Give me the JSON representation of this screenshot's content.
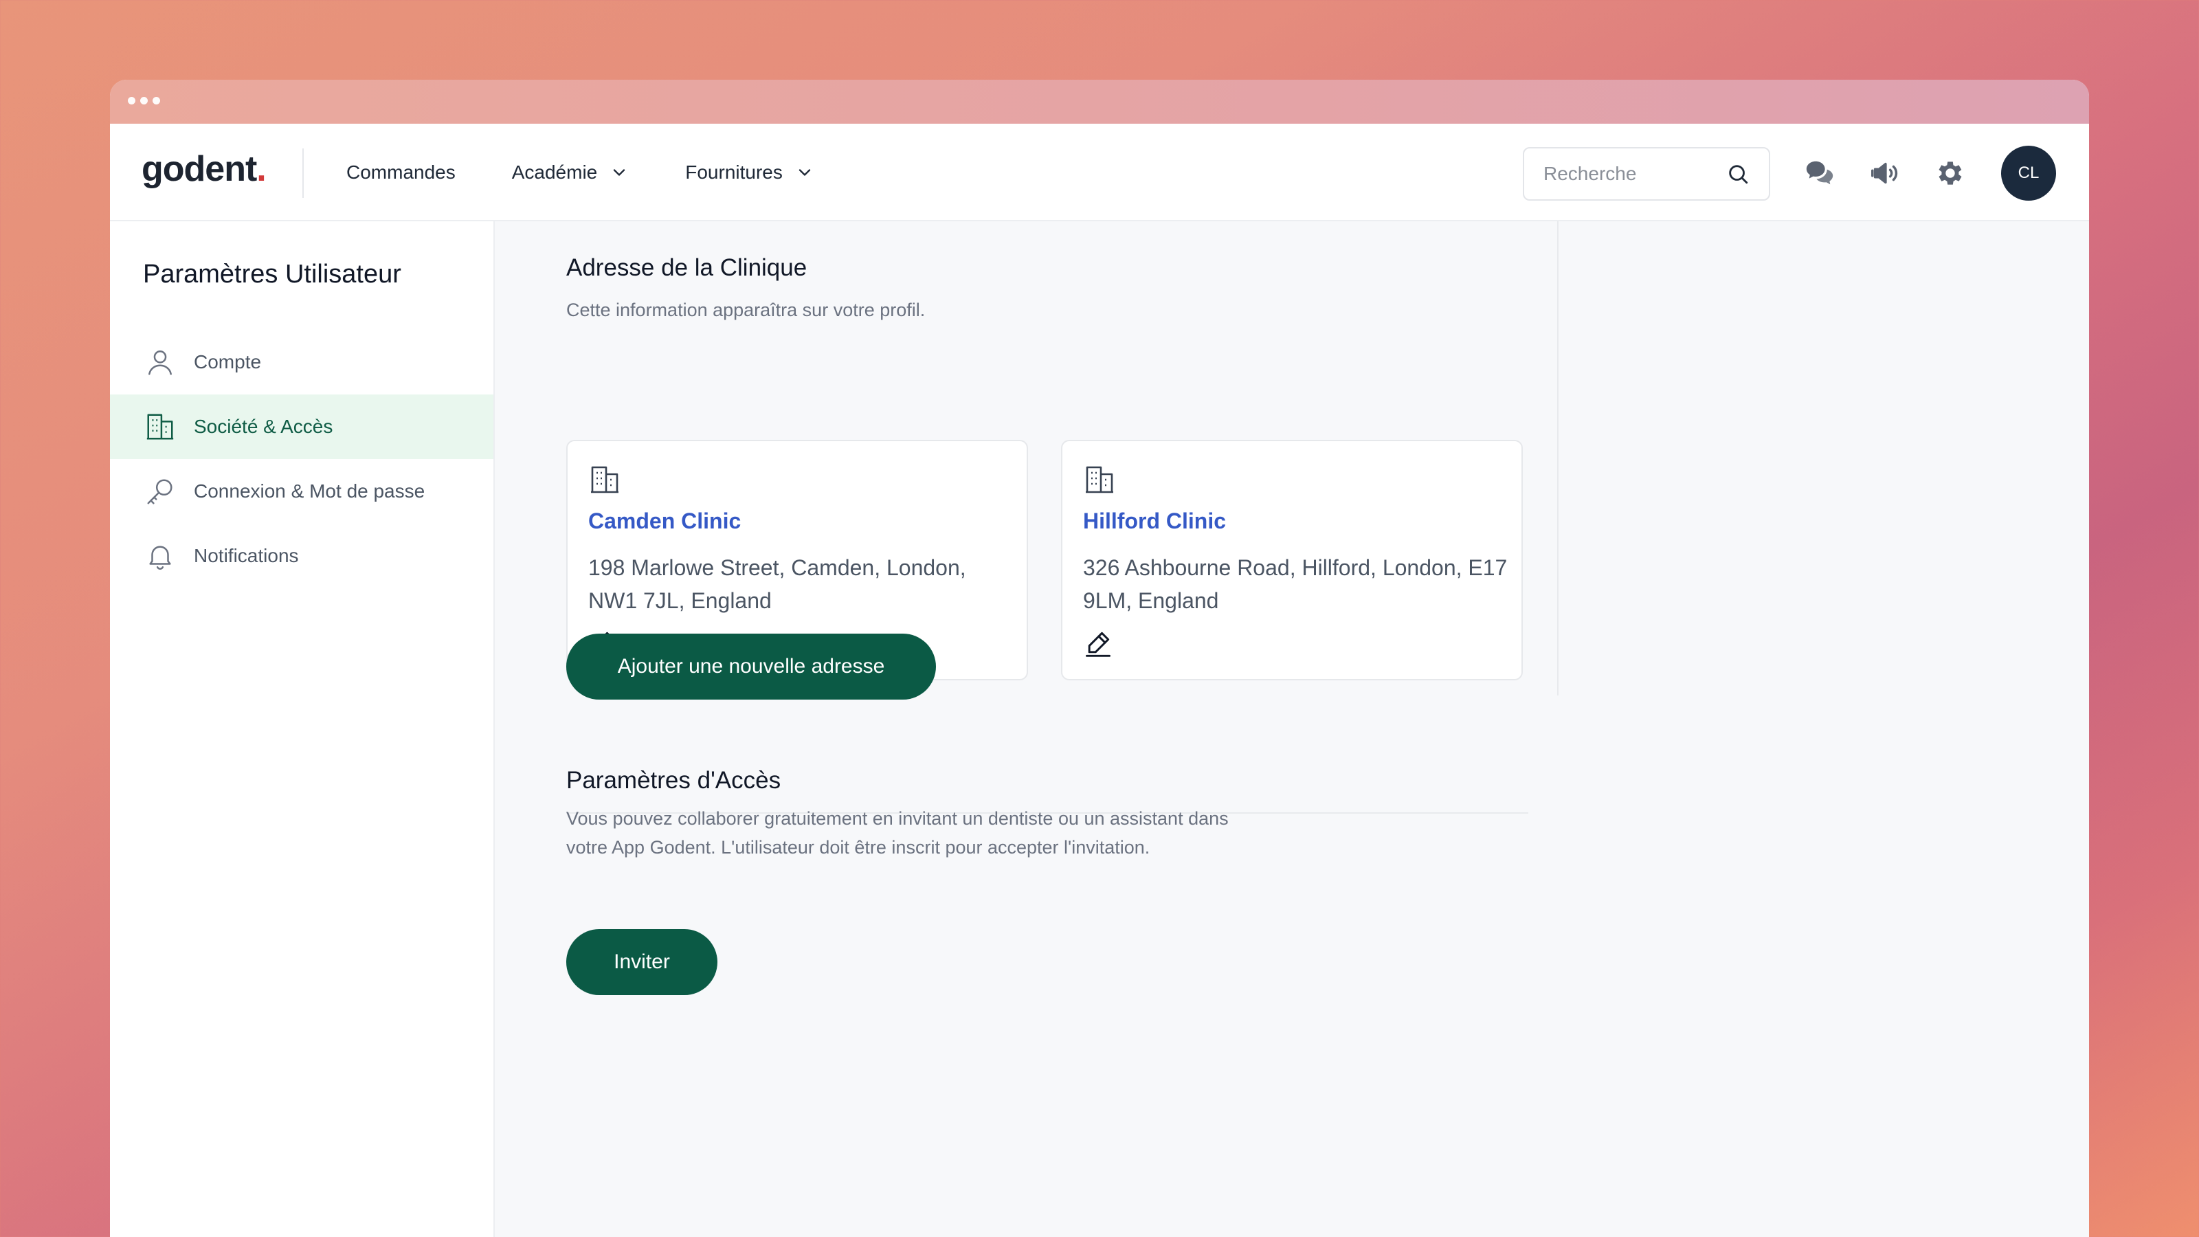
{
  "brand": {
    "name": "godent",
    "dot": "."
  },
  "nav": {
    "links": [
      {
        "label": "Commandes",
        "dropdown": false
      },
      {
        "label": "Académie",
        "dropdown": true
      },
      {
        "label": "Fournitures",
        "dropdown": true
      }
    ]
  },
  "search": {
    "placeholder": "Recherche",
    "value": ""
  },
  "header_icons": [
    "chat-icon",
    "megaphone-icon",
    "gear-icon"
  ],
  "user": {
    "initials": "CL"
  },
  "sidebar": {
    "title": "Paramètres Utilisateur",
    "items": [
      {
        "label": "Compte",
        "icon": "user-icon",
        "active": false
      },
      {
        "label": "Société & Accès",
        "icon": "building-icon",
        "active": true
      },
      {
        "label": "Connexion & Mot de passe",
        "icon": "key-icon",
        "active": false
      },
      {
        "label": "Notifications",
        "icon": "bell-icon",
        "active": false
      }
    ]
  },
  "address_section": {
    "title": "Adresse de la Clinique",
    "description": "Cette information apparaîtra sur votre profil.",
    "clinics": [
      {
        "name": "Camden Clinic",
        "address": "198 Marlowe Street, Camden, London, NW1 7JL, England"
      },
      {
        "name": "Hillford Clinic",
        "address": "326 Ashbourne Road, Hillford, London, E17 9LM, England"
      }
    ],
    "add_button": "Ajouter une nouvelle adresse"
  },
  "access_section": {
    "title": "Paramètres d'Accès",
    "description": "Vous pouvez collaborer gratuitement en invitant un dentiste ou un assistant dans votre App Godent. L'utilisateur doit être inscrit pour accepter l'invitation.",
    "invite_button": "Inviter"
  },
  "colors": {
    "primary": "#0b5a45",
    "active_bg": "#e9f7ee",
    "link": "#3559c6",
    "avatar_bg": "#1b2a3d",
    "logo_dot": "#d23a3a"
  }
}
